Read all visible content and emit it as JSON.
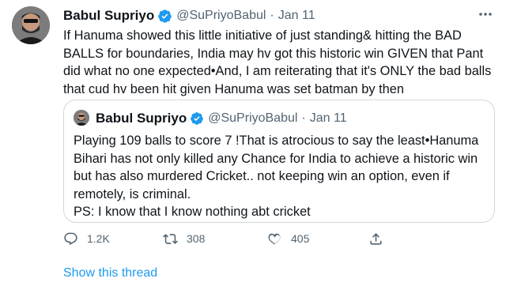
{
  "tweet": {
    "author_name": "Babul Supriyo",
    "handle": "@SuPriyoBabul",
    "separator": "·",
    "date": "Jan 11",
    "text": "If Hanuma showed this little initiative of just standing& hitting the BAD BALLS for boundaries, India may hv got this historic win GIVEN that Pant did what no one expected•And, I am reiterating that it's ONLY the bad balls that cud hv been hit given Hanuma was set batman by then"
  },
  "quoted_tweet": {
    "author_name": "Babul Supriyo",
    "handle": "@SuPriyoBabul",
    "separator": "·",
    "date": "Jan 11",
    "text": "Playing 109 balls to score 7 !That is atrocious to say the least•Hanuma Bihari has not only killed any Chance for India to achieve a historic win but has also murdered Cricket.. not keeping win an option, even if remotely, is criminal.\nPS: I know that I know nothing abt cricket"
  },
  "actions": {
    "reply_count": "1.2K",
    "retweet_count": "308",
    "like_count": "405"
  },
  "show_thread_label": "Show this thread",
  "colors": {
    "text": "#0f1419",
    "secondary": "#536471",
    "link": "#1d9bf0",
    "border": "#cfd9de",
    "verified": "#1d9bf0"
  },
  "icons": [
    "more-icon",
    "verified-icon",
    "reply-icon",
    "retweet-icon",
    "like-icon",
    "share-icon"
  ]
}
